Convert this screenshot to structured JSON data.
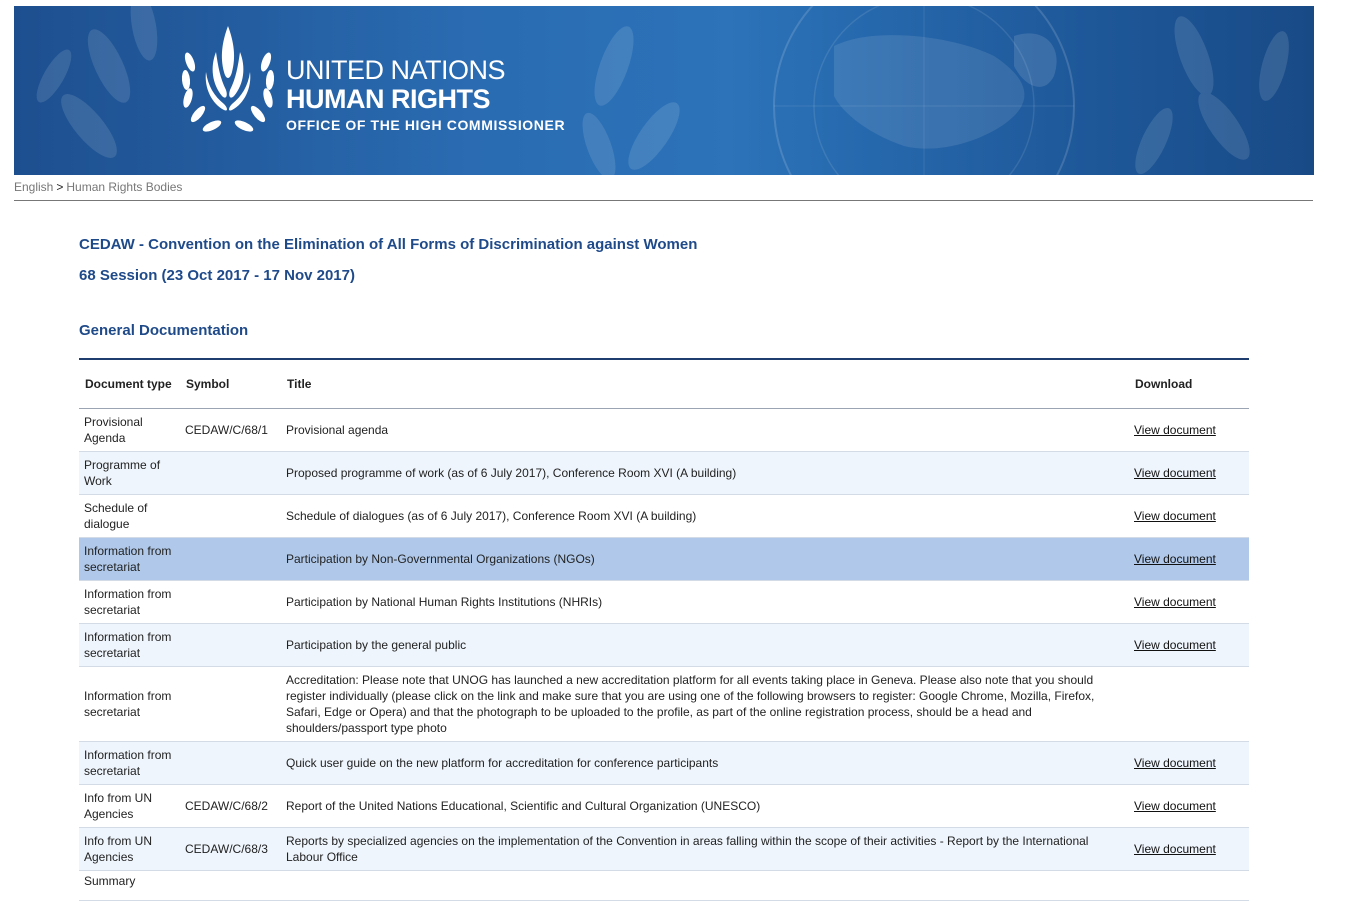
{
  "banner": {
    "line1": "UNITED NATIONS",
    "line2": "HUMAN RIGHTS",
    "line3": "OFFICE OF THE HIGH COMMISSIONER"
  },
  "breadcrumb": {
    "items": [
      "English",
      "Human Rights Bodies"
    ],
    "separator": ">"
  },
  "page": {
    "title": "CEDAW - Convention on the Elimination of All Forms of Discrimination against Women",
    "session": "68 Session (23 Oct 2017 - 17 Nov 2017)",
    "section_heading": "General Documentation"
  },
  "table": {
    "headers": [
      "Document type",
      "Symbol",
      "Title",
      "Download"
    ],
    "rows": [
      {
        "type": "Provisional Agenda",
        "symbol": "CEDAW/C/68/1",
        "title": "Provisional agenda",
        "download": "View document"
      },
      {
        "type": "Programme of Work",
        "symbol": "",
        "title": "Proposed programme of work (as of 6 July 2017), Conference Room XVI (A building)",
        "download": "View document"
      },
      {
        "type": "Schedule of dialogue",
        "symbol": "",
        "title": "Schedule of dialogues (as of 6 July 2017), Conference Room XVI (A building)",
        "download": "View document"
      },
      {
        "type": "Information from secretariat",
        "symbol": "",
        "title": "Participation by Non-Governmental Organizations (NGOs)",
        "download": "View document"
      },
      {
        "type": "Information from secretariat",
        "symbol": "",
        "title": "Participation by National Human Rights Institutions (NHRIs)",
        "download": "View document"
      },
      {
        "type": "Information from secretariat",
        "symbol": "",
        "title": "Participation by the general public",
        "download": "View document"
      },
      {
        "type": "Information from secretariat",
        "symbol": "",
        "title": "Accreditation: Please note that UNOG has launched a new accreditation platform for all events taking place in Geneva. Please also note that you should register individually (please click on the link and make sure that you are using one of the following browsers to register: Google Chrome, Mozilla, Firefox, Safari, Edge or Opera) and that the photograph to be uploaded to the profile, as part of the online registration process, should be a head and shoulders/passport type photo",
        "download": ""
      },
      {
        "type": "Information from secretariat",
        "symbol": "",
        "title": "Quick user guide on the new platform for accreditation for conference participants",
        "download": "View document"
      },
      {
        "type": "Info from UN Agencies",
        "symbol": "CEDAW/C/68/2",
        "title": "Report of the United Nations Educational, Scientific and Cultural Organization (UNESCO)",
        "download": "View document"
      },
      {
        "type": "Info from UN Agencies",
        "symbol": "CEDAW/C/68/3",
        "title": "Reports by specialized agencies on the implementation of the Convention in areas falling within the scope of their activities - Report by the International Labour Office",
        "download": "View document"
      },
      {
        "type": "Summary",
        "symbol": "",
        "title": "",
        "download": ""
      }
    ]
  },
  "colors": {
    "heading_blue": "#1f4a8a",
    "link_blue": "#1a1ac8",
    "highlight_row": "#b0c9ea",
    "alt_row": "#eef5fc"
  }
}
